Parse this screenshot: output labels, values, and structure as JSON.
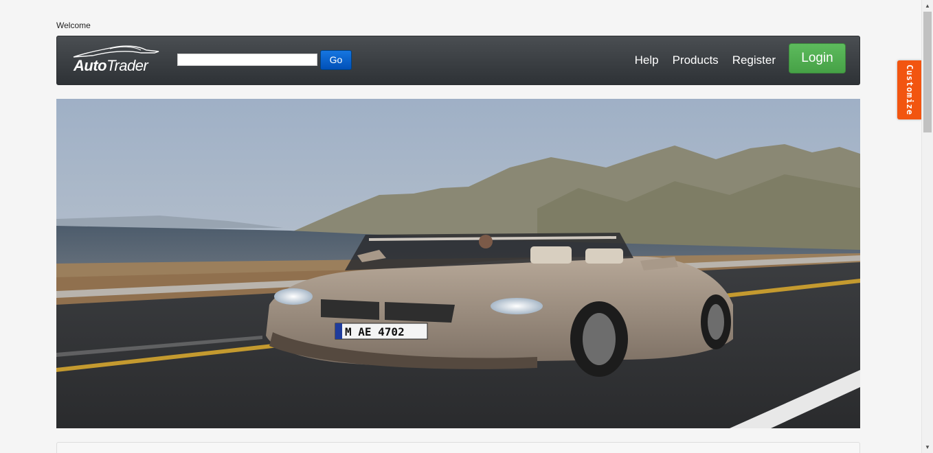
{
  "header": {
    "welcome_text": "Welcome"
  },
  "navbar": {
    "logo_part1": "Auto",
    "logo_part2": "Trader",
    "search_value": "",
    "go_label": "Go",
    "links": [
      "Help",
      "Products",
      "Register"
    ],
    "login_label": "Login"
  },
  "side_tab": {
    "label": "Customize"
  },
  "colors": {
    "navbar": "#3a3e42",
    "go_button": "#0a63cc",
    "login_button": "#51ae51",
    "customize_tab": "#f25510"
  },
  "icons": {
    "scroll_up": "triangle-up",
    "scroll_down": "triangle-down"
  }
}
